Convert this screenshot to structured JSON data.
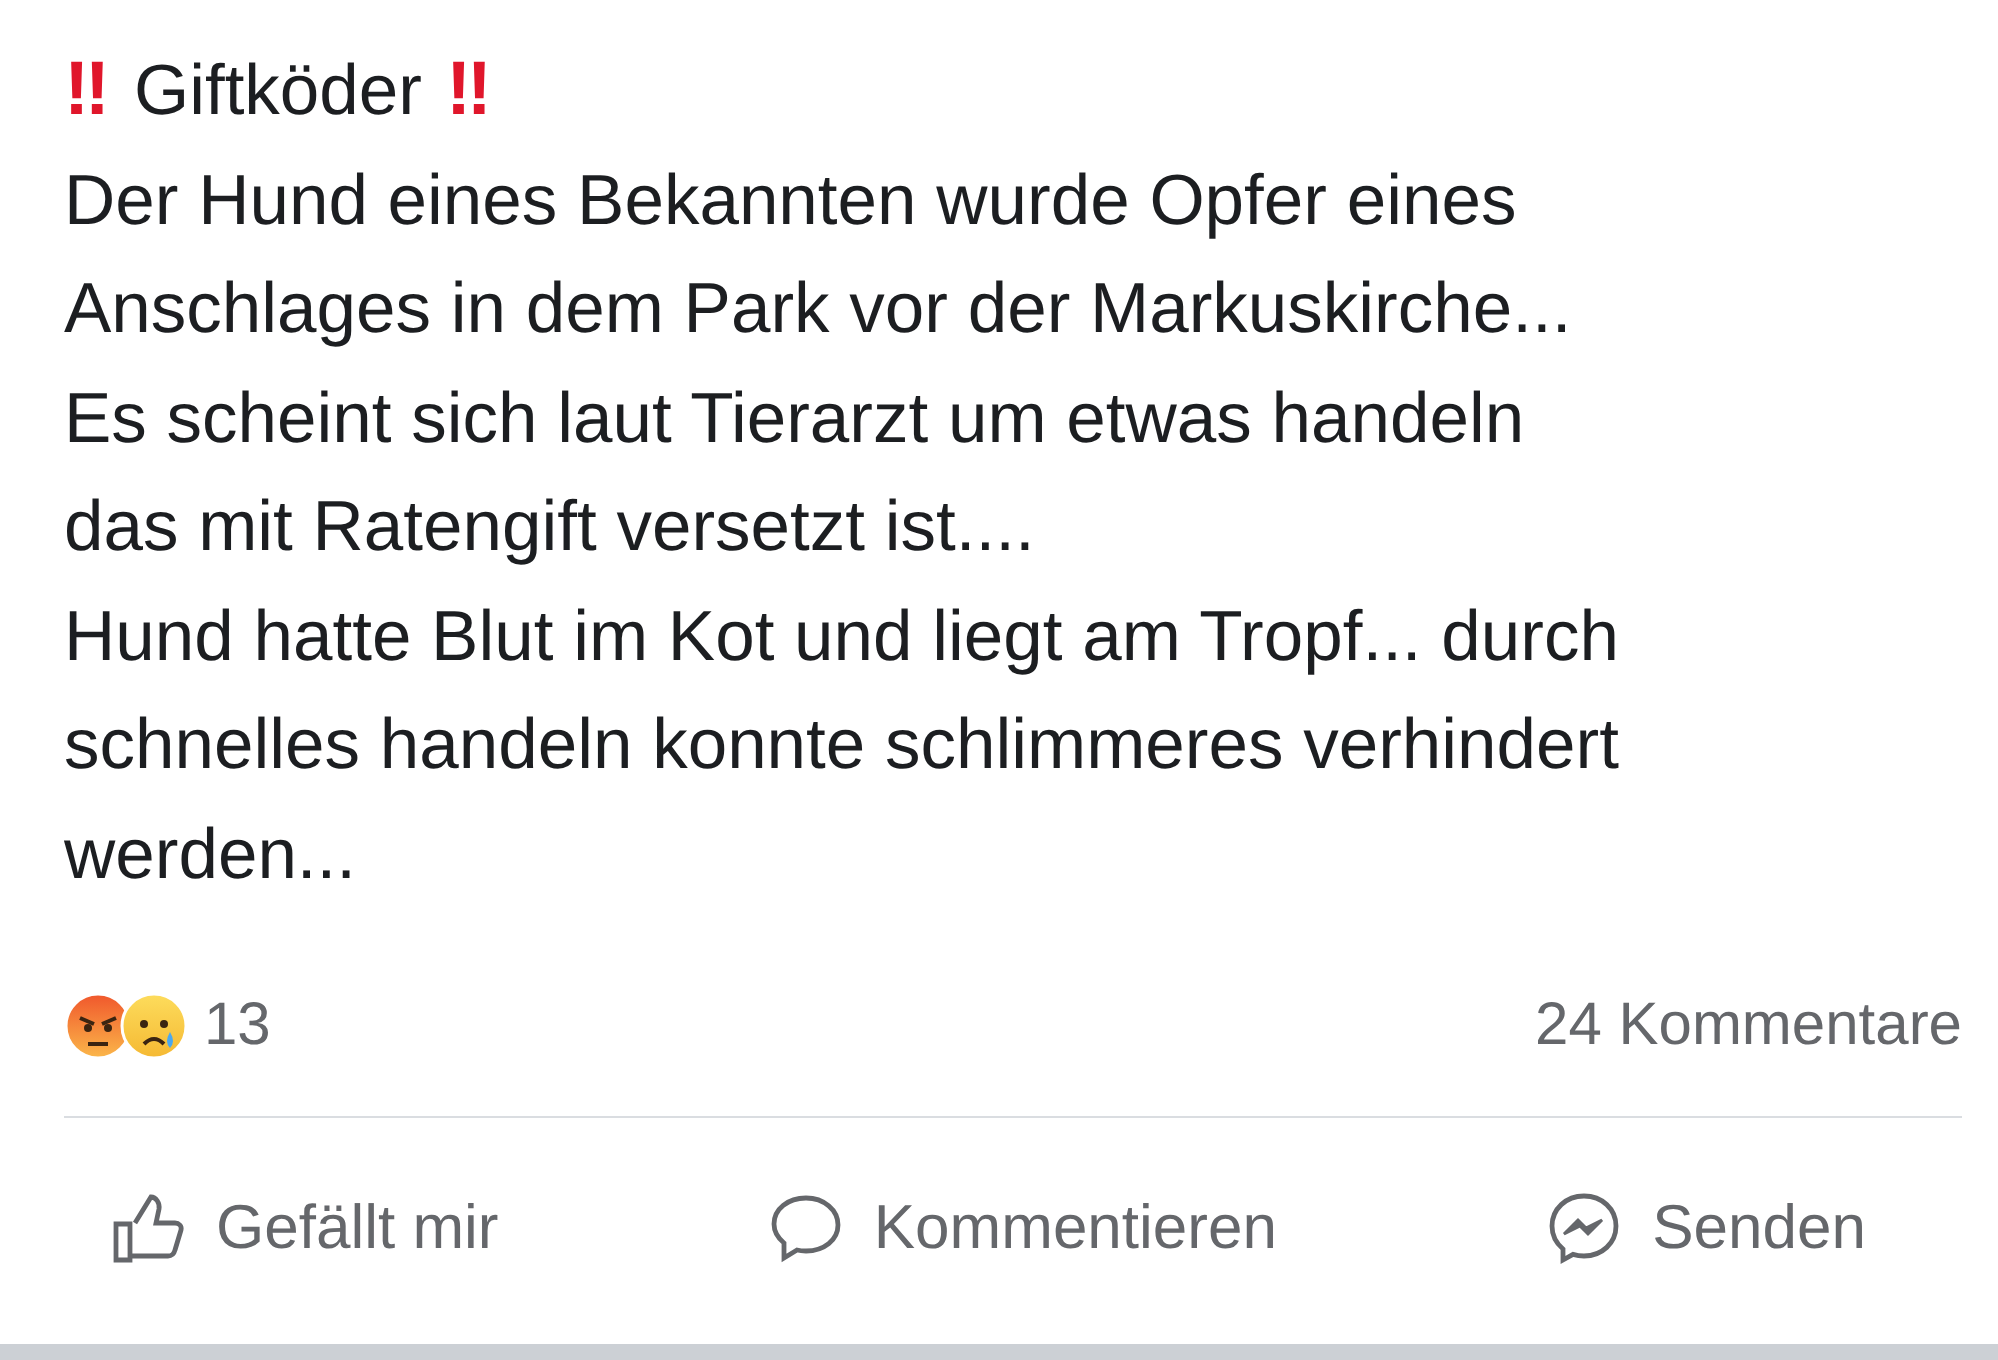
{
  "post": {
    "title": {
      "lead_mark": "‼",
      "text": "Giftköder",
      "trail_mark": "‼"
    },
    "lines": [
      "Der Hund eines Bekannten wurde Opfer eines",
      "Anschlages in dem Park vor der Markuskirche...",
      "Es scheint sich laut Tierarzt um etwas handeln",
      "das mit Ratengift versetzt ist....",
      "Hund hatte Blut im Kot und liegt am Tropf... durch",
      "schnelles handeln konnte schlimmeres verhindert",
      "werden..."
    ]
  },
  "reactions": {
    "icons": [
      {
        "kind": "angry"
      },
      {
        "kind": "sad"
      }
    ],
    "count": "13"
  },
  "comments": "24 Kommentare",
  "actions": [
    {
      "kind": "like",
      "label": "Gefällt mir"
    },
    {
      "kind": "comment",
      "label": "Kommentieren"
    },
    {
      "kind": "send",
      "label": "Senden"
    }
  ]
}
